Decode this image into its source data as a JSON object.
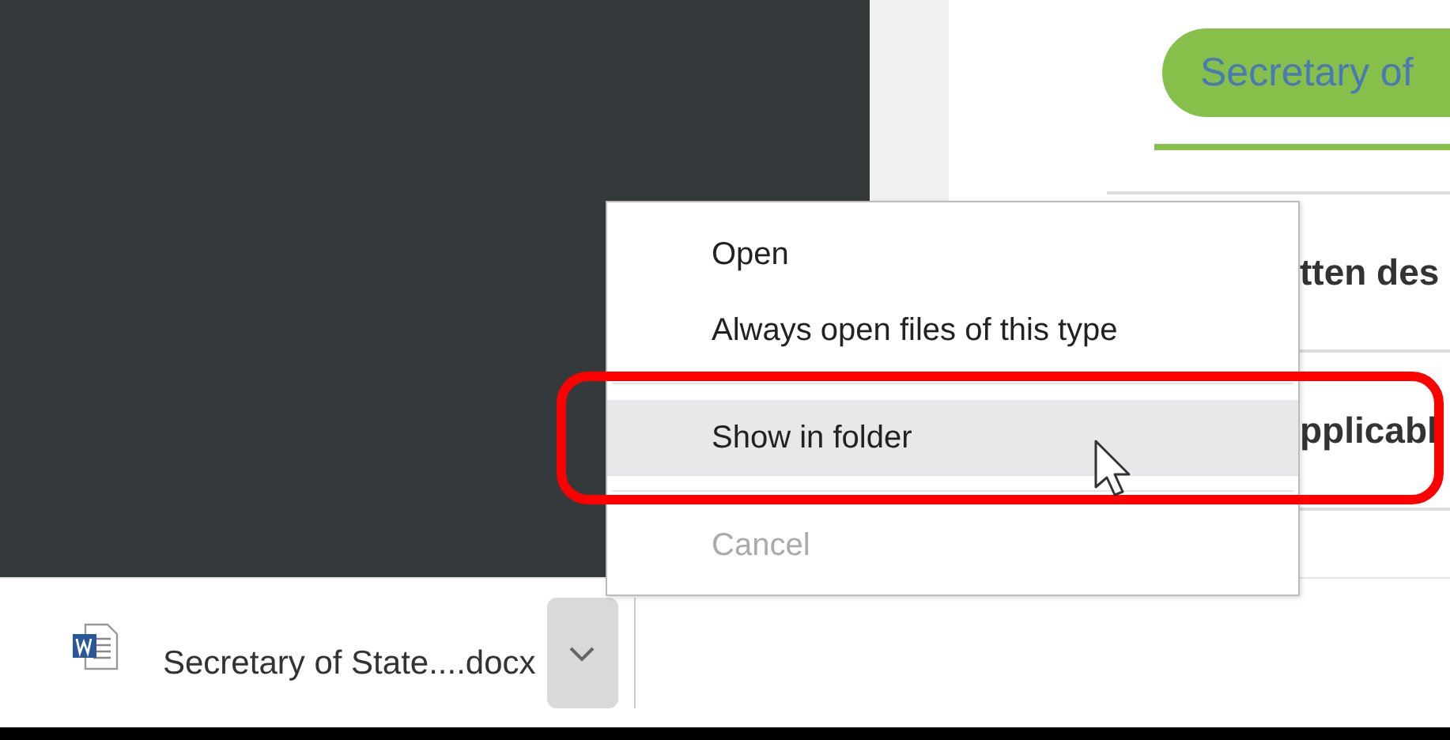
{
  "page": {
    "tab": {
      "label": "Secretary of",
      "selected": true
    },
    "rows": [
      "tten des",
      "pplicabl"
    ]
  },
  "context_menu": {
    "items": [
      {
        "kind": "item",
        "label": "Open",
        "highlighted": false,
        "disabled": false
      },
      {
        "kind": "item",
        "label": "Always open files of this type",
        "highlighted": false,
        "disabled": false
      },
      {
        "kind": "separator"
      },
      {
        "kind": "item",
        "label": "Show in folder",
        "highlighted": true,
        "disabled": false
      },
      {
        "kind": "separator"
      },
      {
        "kind": "item",
        "label": "Cancel",
        "highlighted": false,
        "disabled": true
      }
    ]
  },
  "download_bar": {
    "file_name": "Secretary of State....docx"
  }
}
